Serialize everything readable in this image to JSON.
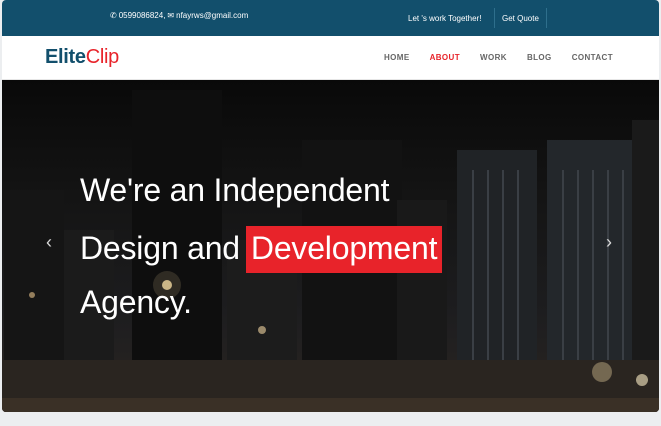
{
  "topbar": {
    "phone_icon": "phone-icon",
    "phone": "0599086824,",
    "mail_icon": "envelope-icon",
    "email": "nfayrws@gmail.com",
    "together": "Let 's work Together!",
    "quote": "Get Quote"
  },
  "logo": {
    "part1": "Elite",
    "part2": "Clip"
  },
  "nav": {
    "items": [
      "HOME",
      "ABOUT",
      "WORK",
      "BLOG",
      "CONTACT"
    ],
    "active": "ABOUT"
  },
  "hero": {
    "line1": "We're an Independent",
    "line2": "Design and",
    "highlight": "Development",
    "line3": "Agency.",
    "prev_icon": "chevron-left-icon",
    "next_icon": "chevron-right-icon"
  },
  "colors": {
    "brand": "#124f6c",
    "accent": "#e8232a"
  }
}
